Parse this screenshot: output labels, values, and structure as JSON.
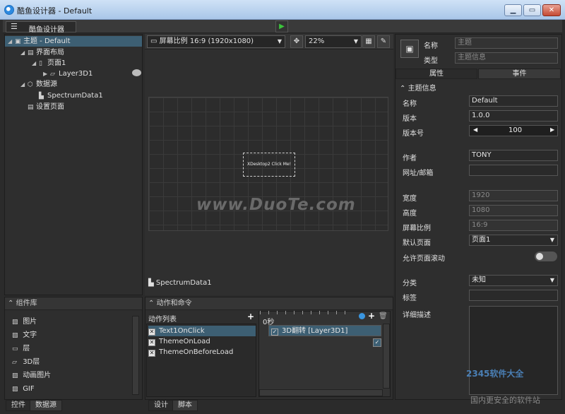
{
  "window": {
    "title": "酷鱼设计器 - Default",
    "controls": [
      "▁",
      "▭",
      "✕"
    ]
  },
  "toolbar": {
    "menu_icon": "☰",
    "app_label": "酷鱼设计器",
    "play_icon": "▶"
  },
  "tree": {
    "items": [
      {
        "label": "主题 - Default",
        "indent": 0,
        "selected": true,
        "icon": "▣",
        "arrow": "◢"
      },
      {
        "label": "界面布局",
        "indent": 1,
        "icon": "▤",
        "arrow": "◢"
      },
      {
        "label": "页面1",
        "indent": 2,
        "icon": "▯",
        "arrow": "◢"
      },
      {
        "label": "Layer3D1",
        "indent": 3,
        "icon": "▱",
        "arrow": "▶"
      },
      {
        "label": "数据源",
        "indent": 1,
        "icon": "⬡",
        "arrow": "◢"
      },
      {
        "label": "SpectrumData1",
        "indent": 2,
        "icon": "▙",
        "arrow": ""
      },
      {
        "label": "设置页面",
        "indent": 1,
        "icon": "▤",
        "arrow": ""
      }
    ]
  },
  "components": {
    "header": "组件库",
    "items": [
      {
        "icon": "▨",
        "label": "图片"
      },
      {
        "icon": "▧",
        "label": "文字"
      },
      {
        "icon": "▭",
        "label": "层"
      },
      {
        "icon": "▱",
        "label": "3D层"
      },
      {
        "icon": "▨",
        "label": "动画图片"
      },
      {
        "icon": "▨",
        "label": "GIF"
      }
    ]
  },
  "left_tabs": [
    "控件",
    "数据源"
  ],
  "canvas": {
    "ratio_select": "屏幕比例 16:9 (1920x1080)",
    "zoom_select": "22%",
    "stage_button_text": "XDesktop2 Click Me!",
    "watermark": "www.DuoTe.com",
    "datasource_label": "SpectrumData1"
  },
  "actions": {
    "header": "动作和命令",
    "list_header": "动作列表",
    "items": [
      {
        "label": "Text1OnClick",
        "selected": true
      },
      {
        "label": "ThemeOnLoad",
        "selected": false
      },
      {
        "label": "ThemeOnBeforeLoad",
        "selected": false
      }
    ],
    "timeline_start": "0秒",
    "anim_item": "3D翻转 [Layer3D1]"
  },
  "center_tabs": [
    "设计",
    "脚本"
  ],
  "properties": {
    "name_label": "名称",
    "name_value": "主题",
    "type_label": "类型",
    "type_value": "主题信息",
    "tabs": [
      "属性",
      "事件"
    ],
    "section": "主题信息",
    "fields": {
      "name": {
        "label": "名称",
        "value": "Default"
      },
      "version": {
        "label": "版本",
        "value": "1.0.0"
      },
      "version_no": {
        "label": "版本号",
        "value": "100"
      },
      "author": {
        "label": "作者",
        "value": "TONY"
      },
      "website": {
        "label": "网址/邮箱",
        "value": ""
      },
      "width": {
        "label": "宽度",
        "value": "1920"
      },
      "height": {
        "label": "高度",
        "value": "1080"
      },
      "ratio": {
        "label": "屏幕比例",
        "value": "16:9"
      },
      "default_page": {
        "label": "默认页面",
        "value": "页面1"
      },
      "scroll": {
        "label": "允许页面滚动"
      },
      "category": {
        "label": "分类",
        "value": "未知"
      },
      "tags": {
        "label": "标签",
        "value": ""
      },
      "description": {
        "label": "详细描述"
      }
    }
  },
  "watermarks": {
    "logo": "2345软件大全",
    "tagline": "国内更安全的软件站"
  }
}
